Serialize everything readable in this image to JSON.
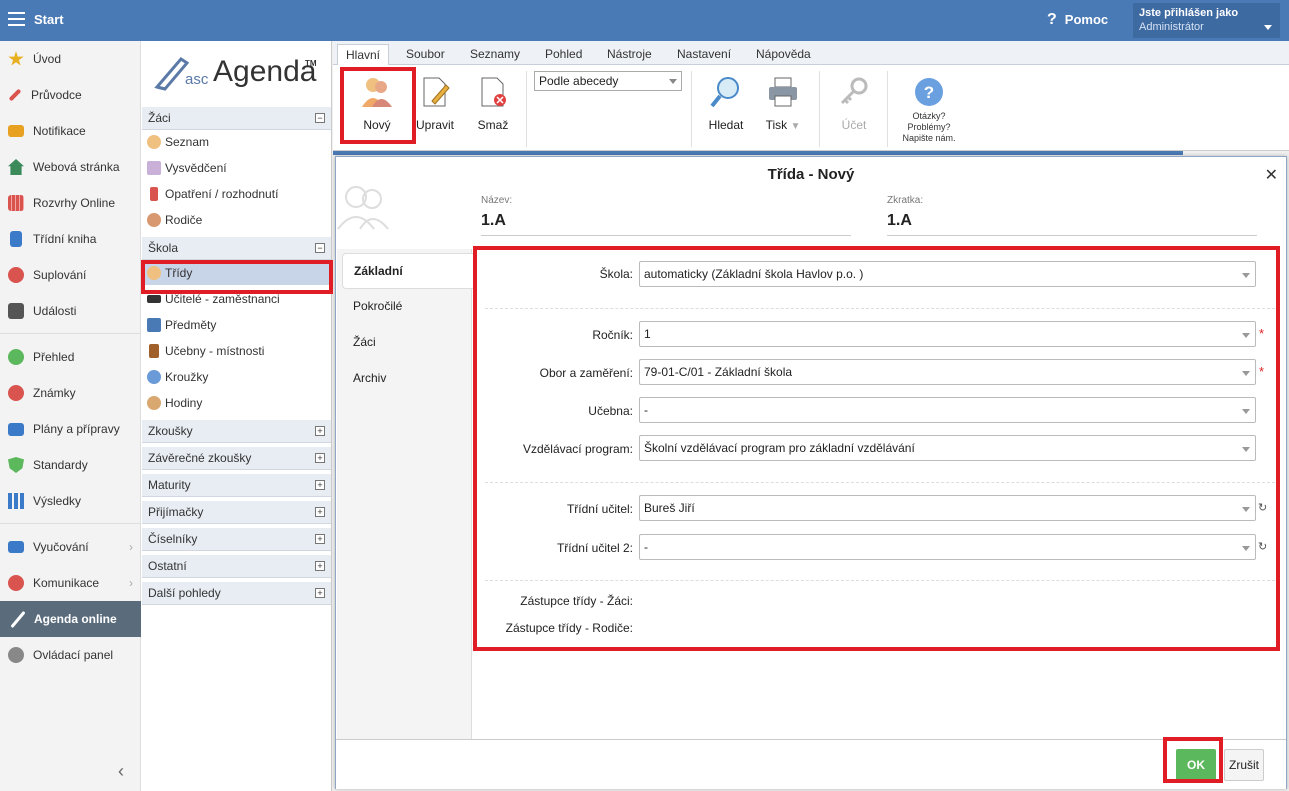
{
  "topbar": {
    "start": "Start",
    "help": "Pomoc",
    "user_line1": "Jste přihlášen jako",
    "user_line2": "Administrátor"
  },
  "leftnav": [
    {
      "label": "Úvod",
      "icon": "star-icon",
      "color": "#e8b020"
    },
    {
      "label": "Průvodce",
      "icon": "wand-icon",
      "color": "#d9534f"
    },
    {
      "label": "Notifikace",
      "icon": "envelope-icon",
      "color": "#e8a020"
    },
    {
      "label": "Webová stránka",
      "icon": "home-icon",
      "color": "#3a8a5a"
    },
    {
      "label": "Rozvrhy Online",
      "icon": "calendar-grid-icon",
      "color": "#d9534f"
    },
    {
      "label": "Třídní kniha",
      "icon": "book-icon",
      "color": "#3a7ac8"
    },
    {
      "label": "Suplování",
      "icon": "person-icon",
      "color": "#d9534f"
    },
    {
      "label": "Události",
      "icon": "calendar-icon",
      "color": "#555"
    },
    {
      "label": "Přehled",
      "icon": "check-circle-icon",
      "color": "#5cb85c"
    },
    {
      "label": "Známky",
      "icon": "grade-icon",
      "color": "#d9534f"
    },
    {
      "label": "Plány a přípravy",
      "icon": "briefcase-icon",
      "color": "#3a7ac8"
    },
    {
      "label": "Standardy",
      "icon": "shield-icon",
      "color": "#5cb85c"
    },
    {
      "label": "Výsledky",
      "icon": "bar-chart-icon",
      "color": "#3a7ac8"
    },
    {
      "label": "Vyučování",
      "icon": "open-book-icon",
      "color": "#3a7ac8"
    },
    {
      "label": "Komunikace",
      "icon": "chat-icon",
      "color": "#d9534f"
    },
    {
      "label": "Agenda online",
      "icon": "pen-icon",
      "color": "#ffffff"
    },
    {
      "label": "Ovládací panel",
      "icon": "gear-icon",
      "color": "#888"
    }
  ],
  "tree": {
    "logo_small": "asc",
    "logo_big": "Agenda",
    "logo_tm": "TM",
    "groups": {
      "zaci": "Žáci",
      "skola": "Škola",
      "zkousky": "Zkoušky",
      "zaverecne": "Závěrečné zkoušky",
      "maturity": "Maturity",
      "prijimacky": "Přijímačky",
      "ciselniky": "Číselníky",
      "ostatni": "Ostatní",
      "dalsi": "Další pohledy"
    },
    "zaci_items": [
      "Seznam",
      "Vysvědčení",
      "Opatření / rozhodnutí",
      "Rodiče"
    ],
    "skola_items": [
      "Třídy",
      "Učitelé - zaměstnanci",
      "Předměty",
      "Učebny - místnosti",
      "Kroužky",
      "Hodiny"
    ]
  },
  "ribbon": {
    "tabs": [
      "Hlavní",
      "Soubor",
      "Seznamy",
      "Pohled",
      "Nástroje",
      "Nastavení",
      "Nápověda"
    ],
    "new": "Nový",
    "edit": "Upravit",
    "delete": "Smaž",
    "sort": "Podle abecedy",
    "search": "Hledat",
    "print": "Tisk",
    "account": "Účet",
    "help1": "Otázky?",
    "help2": "Problémy?",
    "help3": "Napište nám."
  },
  "dialog": {
    "title": "Třída - Nový",
    "name_label": "Název:",
    "name_value": "1.A",
    "abbr_label": "Zkratka:",
    "abbr_value": "1.A",
    "tabs": [
      "Základní",
      "Pokročilé",
      "Žáci",
      "Archiv"
    ],
    "fields": {
      "skola_label": "Škola:",
      "skola_value": "automaticky (Základní škola Havlov p.o. )",
      "rocnik_label": "Ročník:",
      "rocnik_value": "1",
      "obor_label": "Obor a zaměření:",
      "obor_value": "79-01-C/01 - Základní škola",
      "ucebna_label": "Učebna:",
      "ucebna_value": "-",
      "program_label": "Vzdělávací program:",
      "program_value": "Školní vzdělávací program pro základní vzdělávání",
      "ucitel_label": "Třídní učitel:",
      "ucitel_value": "Bureš Jiří",
      "ucitel2_label": "Třídní učitel 2:",
      "ucitel2_value": "-",
      "zast_zaci_label": "Zástupce třídy - Žáci:",
      "zast_rodice_label": "Zástupce třídy - Rodiče:"
    },
    "ok": "OK",
    "cancel": "Zrušit",
    "required_mark": "*",
    "refresh_glyph": "↻"
  }
}
